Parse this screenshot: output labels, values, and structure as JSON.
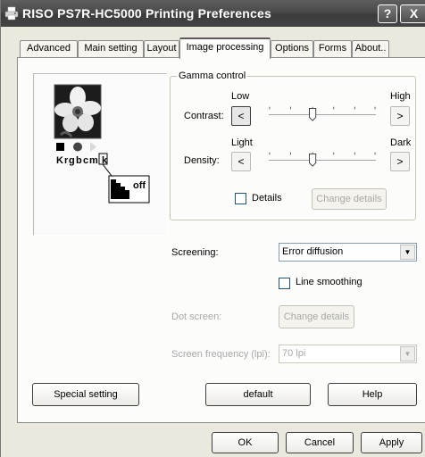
{
  "window": {
    "title": "RISO PS7R-HC5000 Printing Preferences",
    "help_label": "?",
    "close_label": "X"
  },
  "tabs": [
    {
      "label": "Advanced"
    },
    {
      "label": "Main setting"
    },
    {
      "label": "Layout"
    },
    {
      "label": "Image processing",
      "active": true
    },
    {
      "label": "Options"
    },
    {
      "label": "Forms"
    },
    {
      "label": "About.."
    }
  ],
  "preview": {
    "channel_labels": [
      "K",
      "r",
      "g",
      "b",
      "c",
      "m",
      "k"
    ],
    "inset_label": "off"
  },
  "gamma": {
    "title": "Gamma control",
    "contrast": {
      "label": "Contrast:",
      "low": "Low",
      "high": "High",
      "decrease": "<",
      "increase": ">",
      "level": 0.5
    },
    "density": {
      "label": "Density:",
      "low": "Light",
      "high": "Dark",
      "decrease": "<",
      "increase": ">",
      "level": 0.5
    },
    "details_label": "Details",
    "details_checked": false,
    "change_details": "Change details"
  },
  "screening": {
    "label": "Screening:",
    "value": "Error diffusion",
    "line_smoothing_label": "Line smoothing",
    "line_smoothing_checked": false
  },
  "dot_screen": {
    "label": "Dot screen:",
    "button": "Change details"
  },
  "screen_frequency": {
    "label": "Screen frequency (lpi):",
    "value": "70 lpi"
  },
  "buttons": {
    "special": "Special setting",
    "default": "default",
    "help": "Help",
    "ok": "OK",
    "cancel": "Cancel",
    "apply": "Apply"
  },
  "colors": {
    "title_bar": "#4a4a4a",
    "dialog_bg": "#ebe9dd",
    "panel_bg": "#fcfcfb",
    "disabled_text": "#a8a8a8"
  }
}
